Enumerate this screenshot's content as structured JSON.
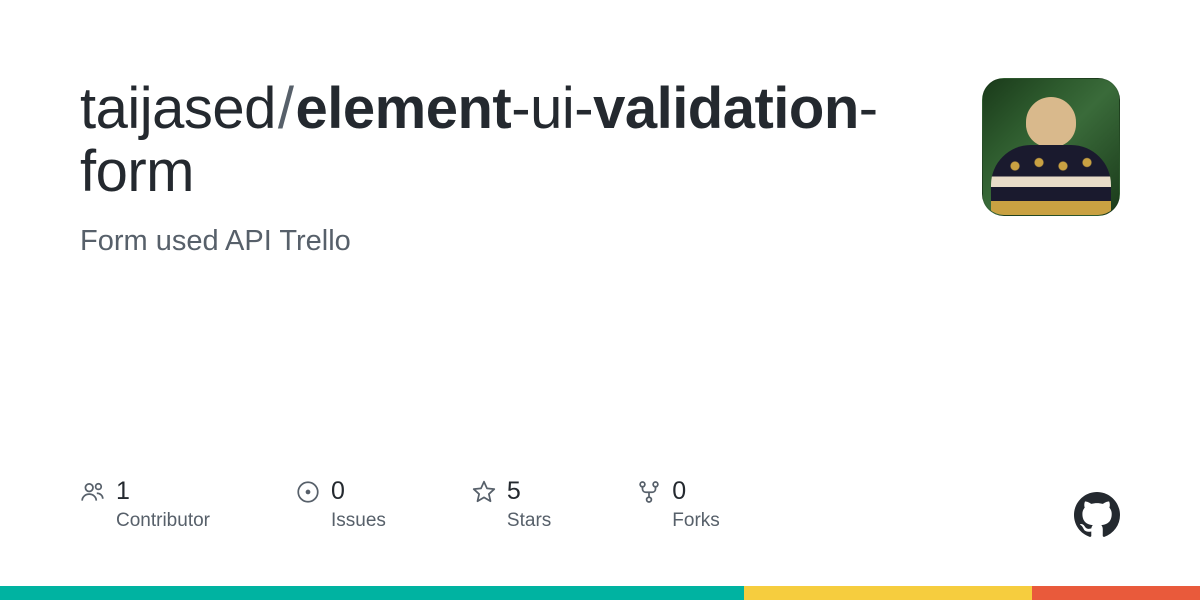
{
  "repo": {
    "owner": "taijased",
    "name_part1": "element",
    "name_part2": "ui",
    "name_part3": "validation",
    "name_part4": "form",
    "description": "Form used API Trello"
  },
  "stats": {
    "contributors": {
      "count": "1",
      "label": "Contributor"
    },
    "issues": {
      "count": "0",
      "label": "Issues"
    },
    "stars": {
      "count": "5",
      "label": "Stars"
    },
    "forks": {
      "count": "0",
      "label": "Forks"
    }
  },
  "rainbow_colors": [
    "#00b3a1",
    "#f6cd3e",
    "#e95a3b"
  ],
  "rainbow_widths": [
    "62%",
    "24%",
    "14%"
  ]
}
